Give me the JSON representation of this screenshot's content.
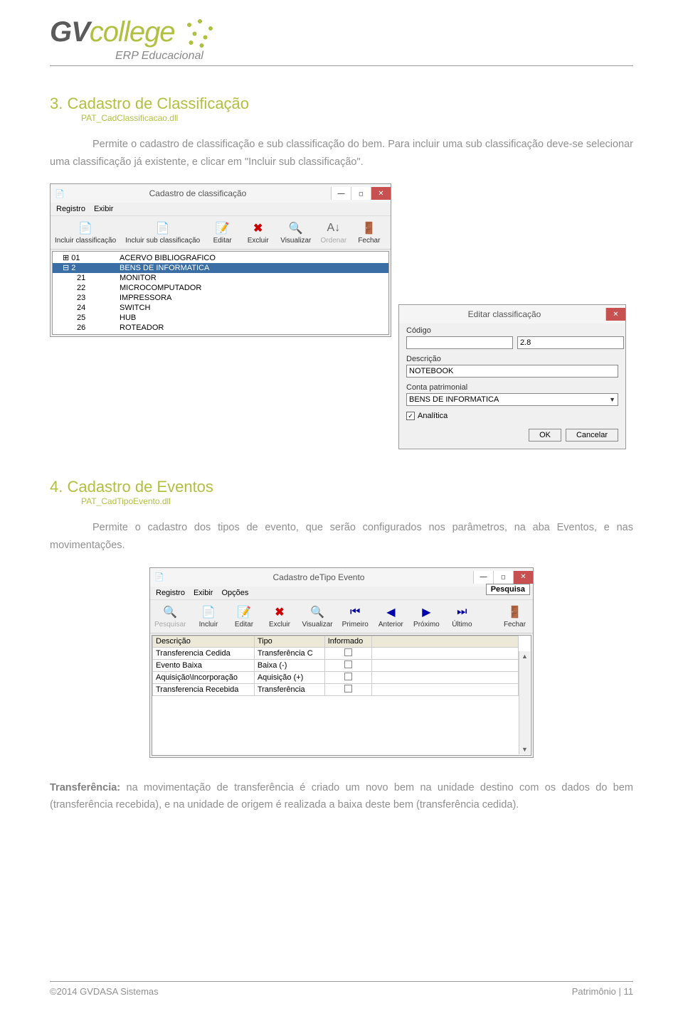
{
  "header": {
    "logo_gv": "GV",
    "logo_college": "college",
    "tagline": "ERP Educacional"
  },
  "section3": {
    "title": "3. Cadastro de Classificação",
    "subtitle": "PAT_CadClassificacao.dll",
    "paragraph": "Permite o cadastro de classificação e sub classificação do bem. Para incluir uma sub classificação deve-se selecionar uma classificação já existente, e clicar em \"Incluir sub classificação\"."
  },
  "win1": {
    "title": "Cadastro de classificação",
    "menu": [
      "Registro",
      "Exibir"
    ],
    "toolbar": [
      {
        "label": "Incluir classificação",
        "icon": "doc"
      },
      {
        "label": "Incluir sub classificação",
        "icon": "doc"
      },
      {
        "label": "Editar",
        "icon": "doc-pencil"
      },
      {
        "label": "Excluir",
        "icon": "x"
      },
      {
        "label": "Visualizar",
        "icon": "mag"
      },
      {
        "label": "Ordenar",
        "icon": "sort",
        "disabled": true
      },
      {
        "label": "Fechar",
        "icon": "door"
      }
    ],
    "rows": [
      {
        "code": "01",
        "desc": "ACERVO BIBLIOGRAFICO",
        "ind": 10,
        "prefix": "⊞"
      },
      {
        "code": "2",
        "desc": "BENS DE INFORMATICA",
        "ind": 10,
        "prefix": "⊟",
        "sel": true
      },
      {
        "code": "21",
        "desc": "MONITOR",
        "ind": 30
      },
      {
        "code": "22",
        "desc": "MICROCOMPUTADOR",
        "ind": 30
      },
      {
        "code": "23",
        "desc": "IMPRESSORA",
        "ind": 30
      },
      {
        "code": "24",
        "desc": "SWITCH",
        "ind": 30
      },
      {
        "code": "25",
        "desc": "HUB",
        "ind": 30
      },
      {
        "code": "26",
        "desc": "ROTEADOR",
        "ind": 30
      }
    ]
  },
  "win2": {
    "title": "Editar classificação",
    "codigo_label": "Código",
    "codigo_val1": "",
    "codigo_val2": "2.8",
    "descricao_label": "Descrição",
    "descricao_val": "NOTEBOOK",
    "conta_label": "Conta patrimonial",
    "conta_val": "BENS DE INFORMATICA",
    "analitica_label": "Analítica",
    "ok": "OK",
    "cancel": "Cancelar"
  },
  "section4": {
    "title": "4. Cadastro de Eventos",
    "subtitle": "PAT_CadTipoEvento.dll",
    "paragraph": "Permite o cadastro dos tipos de evento, que serão configurados nos parâmetros, na aba Eventos, e nas movimentações."
  },
  "win3": {
    "title": "Cadastro deTipo Evento",
    "menu": [
      "Registro",
      "Exibir",
      "Opções"
    ],
    "search": "Pesquisa",
    "toolbar": [
      {
        "label": "Pesquisar",
        "icon": "mag",
        "disabled": true
      },
      {
        "label": "Incluir",
        "icon": "doc"
      },
      {
        "label": "Editar",
        "icon": "doc-pencil"
      },
      {
        "label": "Excluir",
        "icon": "x"
      },
      {
        "label": "Visualizar",
        "icon": "mag"
      },
      {
        "label": "Primeiro",
        "icon": "first"
      },
      {
        "label": "Anterior",
        "icon": "prev"
      },
      {
        "label": "Próximo",
        "icon": "next"
      },
      {
        "label": "Último",
        "icon": "last"
      },
      {
        "label": "Fechar",
        "icon": "door",
        "right": true
      }
    ],
    "columns": [
      "Descrição",
      "Tipo",
      "Informado"
    ],
    "rows": [
      {
        "desc": "Transferencia Cedida",
        "tipo": "Transferência C",
        "inf": false
      },
      {
        "desc": "Evento Baixa",
        "tipo": "Baixa (-)",
        "inf": false
      },
      {
        "desc": "Aquisição\\Incorporação",
        "tipo": "Aquisição (+)",
        "inf": false
      },
      {
        "desc": "Transferencia Recebida",
        "tipo": "Transferência",
        "inf": false
      }
    ]
  },
  "para_transfer_lead": "Transferência:",
  "para_transfer": " na movimentação de transferência é criado um novo bem na unidade destino com os dados do bem (transferência recebida), e na unidade de origem é realizada a baixa deste bem (transferência cedida).",
  "footer": {
    "left": "©2014 GVDASA Sistemas",
    "right": "Patrimônio | 11"
  }
}
